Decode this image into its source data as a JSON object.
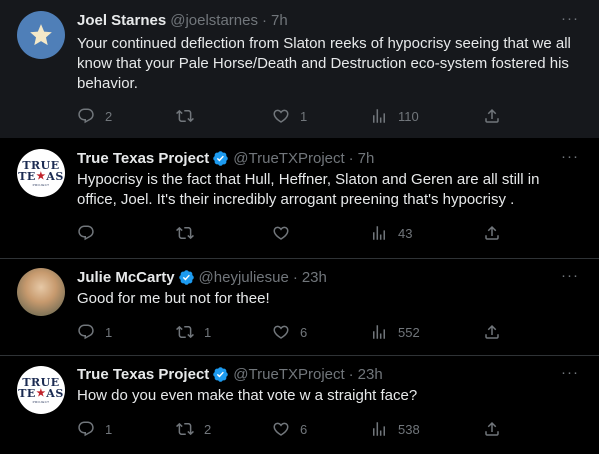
{
  "tweets": [
    {
      "name": "Joel Starnes",
      "handle": "@joelstarnes",
      "time": "7h",
      "verified": false,
      "avatar_icon": "star-icon",
      "text": "Your continued deflection from Slaton reeks of hypocrisy seeing that we all know that your Pale Horse/Death and Destruction eco-system fostered his behavior.",
      "replies": "2",
      "retweets": "",
      "likes": "1",
      "views": "110"
    },
    {
      "name": "True Texas Project",
      "handle": "@TrueTXProject",
      "time": "7h",
      "verified": true,
      "avatar_text": [
        "TRUE",
        "TE",
        "AS",
        "PROJECT"
      ],
      "text": "Hypocrisy is the fact that Hull, Heffner, Slaton and Geren are all still in office, Joel. It's their incredibly arrogant preening that's hypocrisy .",
      "replies": "",
      "retweets": "",
      "likes": "",
      "views": "43"
    },
    {
      "name": "Julie McCarty",
      "handle": "@heyjuliesue",
      "time": "23h",
      "verified": true,
      "text": "Good for me but not for thee!",
      "replies": "1",
      "retweets": "1",
      "likes": "6",
      "views": "552"
    },
    {
      "name": "True Texas Project",
      "handle": "@TrueTXProject",
      "time": "23h",
      "verified": true,
      "avatar_text": [
        "TRUE",
        "TE",
        "AS",
        "PROJECT"
      ],
      "text": "How do you even make that vote w a straight face?",
      "replies": "1",
      "retweets": "2",
      "likes": "6",
      "views": "538"
    }
  ],
  "separator": "·",
  "more_glyph": "···",
  "colors": {
    "background": "#000000",
    "highlight": "#16181c",
    "text": "#e7e9ea",
    "muted": "#71767b",
    "verified": "#1d9bf0",
    "divider": "#2f3336"
  }
}
